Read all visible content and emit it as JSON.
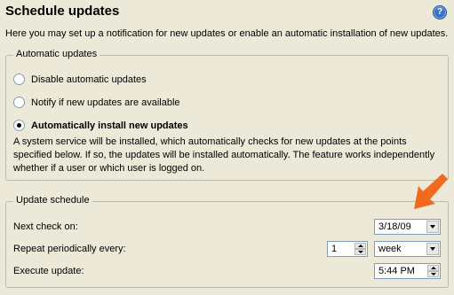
{
  "header": {
    "title": "Schedule updates",
    "help_icon": "question-mark-icon",
    "intro": "Here you may set up a notification for new updates or enable an automatic installation of new updates."
  },
  "automatic_updates": {
    "legend": "Automatic updates",
    "options": [
      {
        "label": "Disable automatic updates",
        "selected": false
      },
      {
        "label": "Notify if new updates are available",
        "selected": false
      },
      {
        "label": "Automatically install new updates",
        "selected": true
      }
    ],
    "description": "A system service will be installed, which automatically checks for new updates at the points specified below. If so, the updates will be installed automatically. The feature works independently whether if a user or which user is logged on."
  },
  "update_schedule": {
    "legend": "Update schedule",
    "next_check_label": "Next check on:",
    "next_check_value": "3/18/09",
    "repeat_label": "Repeat periodically every:",
    "repeat_count": "1",
    "repeat_unit": "week",
    "execute_label": "Execute update:",
    "execute_value": "5:44 PM"
  },
  "annotation": {
    "arrow_color": "#f26a1f"
  }
}
